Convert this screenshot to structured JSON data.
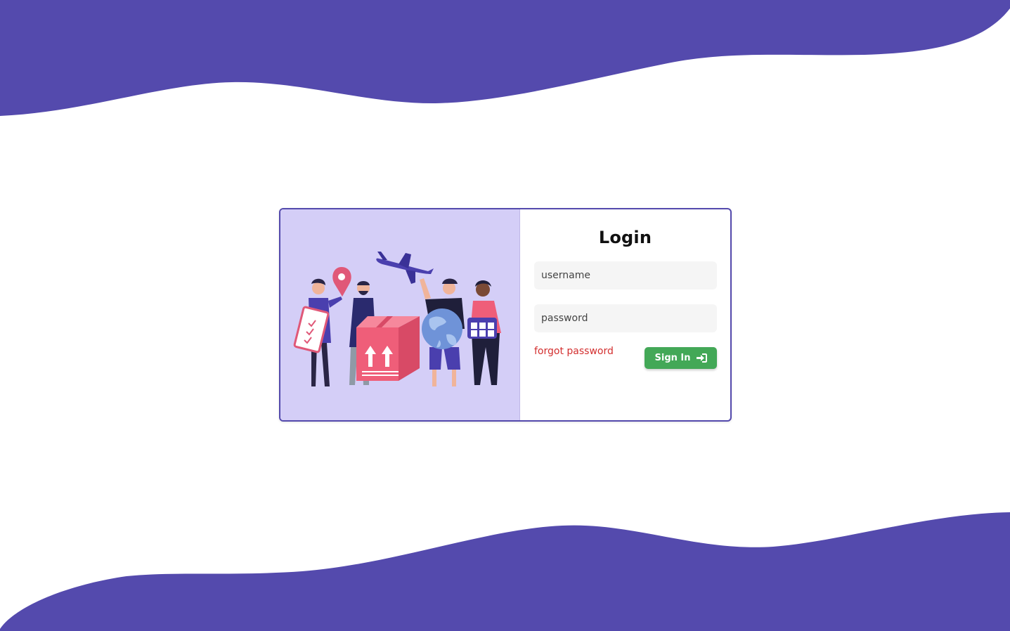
{
  "colors": {
    "wave": "#544aad",
    "card_border": "#544aad",
    "illustration_bg": "#d4cef7",
    "field_bg": "#f5f5f5",
    "forgot_link": "#d32f2f",
    "signin_bg": "#43a857"
  },
  "login": {
    "title": "Login",
    "username_placeholder": "username",
    "username_value": "",
    "password_placeholder": "password",
    "password_value": "",
    "forgot_password": "forgot password",
    "signin_label": "Sign In",
    "signin_icon": "sign-in-icon"
  },
  "illustration": {
    "icons": [
      "location-pin-icon",
      "airplane-icon",
      "package-box-icon",
      "globe-icon",
      "calendar-icon",
      "checklist-clipboard-icon"
    ]
  }
}
